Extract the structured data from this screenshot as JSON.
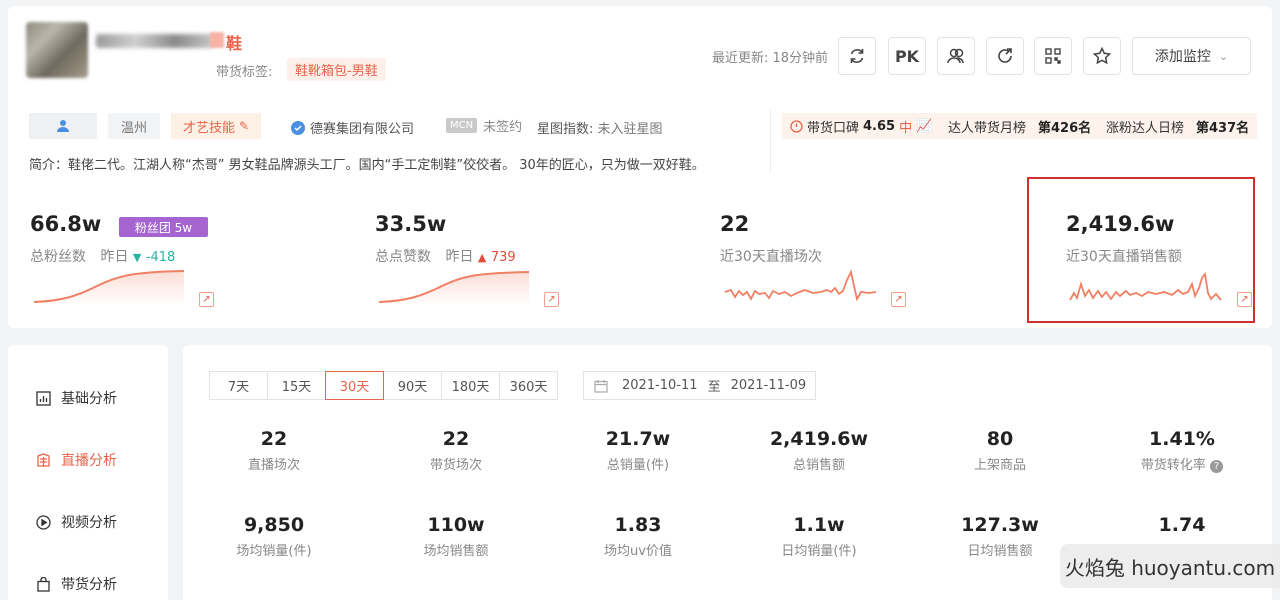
{
  "profile": {
    "name_suffix": "鞋",
    "label_title": "带货标签:",
    "label_tag": "鞋靴箱包-男鞋",
    "last_updated": "最近更新: 18分钟前",
    "actions": {
      "pk": "PK",
      "monitor": "添加监控"
    }
  },
  "info": {
    "city": "温州",
    "talent": "才艺技能",
    "company": "德赛集团有限公司",
    "mcn_badge": "MCN",
    "mcn_status": "未签约",
    "star_label": "星图指数:",
    "star_value": "未入驻星图",
    "intro": "简介：鞋佬二代。江湖人称“杰哥” 男女鞋品牌源头工厂。国内“手工定制鞋”佼佼者。 30年的匠心，只为做一双好鞋。"
  },
  "ranks": {
    "reputation_label": "带货口碑",
    "reputation_value": "4.65",
    "reputation_level": "中",
    "monthly_label": "达人带货月榜",
    "monthly_value": "第426名",
    "daily_label": "涨粉达人日榜",
    "daily_value": "第437名"
  },
  "metrics": {
    "fans": {
      "value": "66.8w",
      "label": "总粉丝数",
      "yesterday": "昨日",
      "delta": "-418",
      "badge": "粉丝团 5w"
    },
    "likes": {
      "value": "33.5w",
      "label": "总点赞数",
      "yesterday": "昨日",
      "delta": "739"
    },
    "lives": {
      "value": "22",
      "label": "近30天直播场次"
    },
    "sales": {
      "value": "2,419.6w",
      "label": "近30天直播销售额"
    }
  },
  "sidebar": {
    "items": [
      {
        "label": "基础分析",
        "icon": "bar-chart-icon"
      },
      {
        "label": "直播分析",
        "icon": "live-icon"
      },
      {
        "label": "视频分析",
        "icon": "play-icon"
      },
      {
        "label": "带货分析",
        "icon": "bag-icon"
      }
    ],
    "active_index": 1
  },
  "ranges": [
    "7天",
    "15天",
    "30天",
    "90天",
    "180天",
    "360天"
  ],
  "active_range": "30天",
  "date_range": {
    "start": "2021-10-11",
    "sep": "至",
    "end": "2021-11-09"
  },
  "stats": [
    {
      "value": "22",
      "label": "直播场次"
    },
    {
      "value": "22",
      "label": "带货场次"
    },
    {
      "value": "21.7w",
      "label": "总销量(件)"
    },
    {
      "value": "2,419.6w",
      "label": "总销售额"
    },
    {
      "value": "80",
      "label": "上架商品"
    },
    {
      "value": "1.41%",
      "label": "带货转化率"
    },
    {
      "value": "9,850",
      "label": "场均销量(件)"
    },
    {
      "value": "110w",
      "label": "场均销售额"
    },
    {
      "value": "1.83",
      "label": "场均uv价值"
    },
    {
      "value": "1.1w",
      "label": "日均销量(件)"
    },
    {
      "value": "127.3w",
      "label": "日均销售额"
    },
    {
      "value": "1.74",
      "label": ""
    }
  ],
  "watermark": "火焰兔 huoyantu.com",
  "colors": {
    "accent": "#e8644a",
    "fan_badge": "#a564d0",
    "highlight": "#d0312d",
    "delta_down": "#2bb3a3",
    "delta_up": "#e24c3b"
  }
}
